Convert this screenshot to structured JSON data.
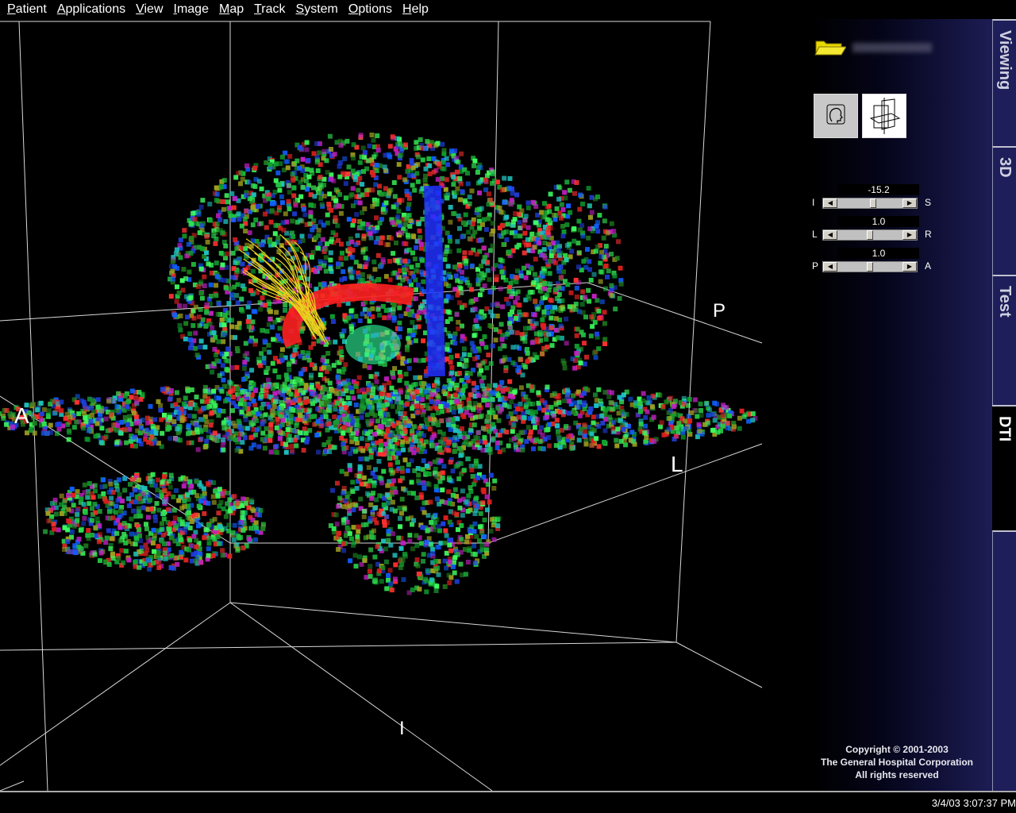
{
  "menu": [
    {
      "key": "P",
      "rest": "atient"
    },
    {
      "key": "A",
      "rest": "pplications"
    },
    {
      "key": "V",
      "rest": "iew"
    },
    {
      "key": "I",
      "rest": "mage"
    },
    {
      "key": "M",
      "rest": "ap"
    },
    {
      "key": "T",
      "rest": "rack"
    },
    {
      "key": "S",
      "rest": "ystem"
    },
    {
      "key": "O",
      "rest": "ptions"
    },
    {
      "key": "H",
      "rest": "elp"
    }
  ],
  "viewport": {
    "labels": {
      "a": "A",
      "p": "P",
      "l": "L",
      "i": "I"
    }
  },
  "panel": {
    "sliders": [
      {
        "value": "-15.2",
        "left": "I",
        "right": "S",
        "fraction": 0.55
      },
      {
        "value": "1.0",
        "left": "L",
        "right": "R",
        "fraction": 0.5
      },
      {
        "value": "1.0",
        "left": "P",
        "right": "A",
        "fraction": 0.5
      }
    ],
    "copyright": [
      "Copyright © 2001-2003",
      "The General Hospital Corporation",
      "All rights reserved"
    ]
  },
  "tabs": [
    {
      "label": "Viewing",
      "active": false
    },
    {
      "label": "3D",
      "active": false
    },
    {
      "label": "Test",
      "active": false
    },
    {
      "label": "DTI",
      "active": true
    }
  ],
  "status": {
    "clock": "3/4/03 3:07:37 PM"
  },
  "colors": {
    "panel_accent": "#1d1d55",
    "tab_bg": "#1e1e5a",
    "tract": "#e8d020"
  }
}
